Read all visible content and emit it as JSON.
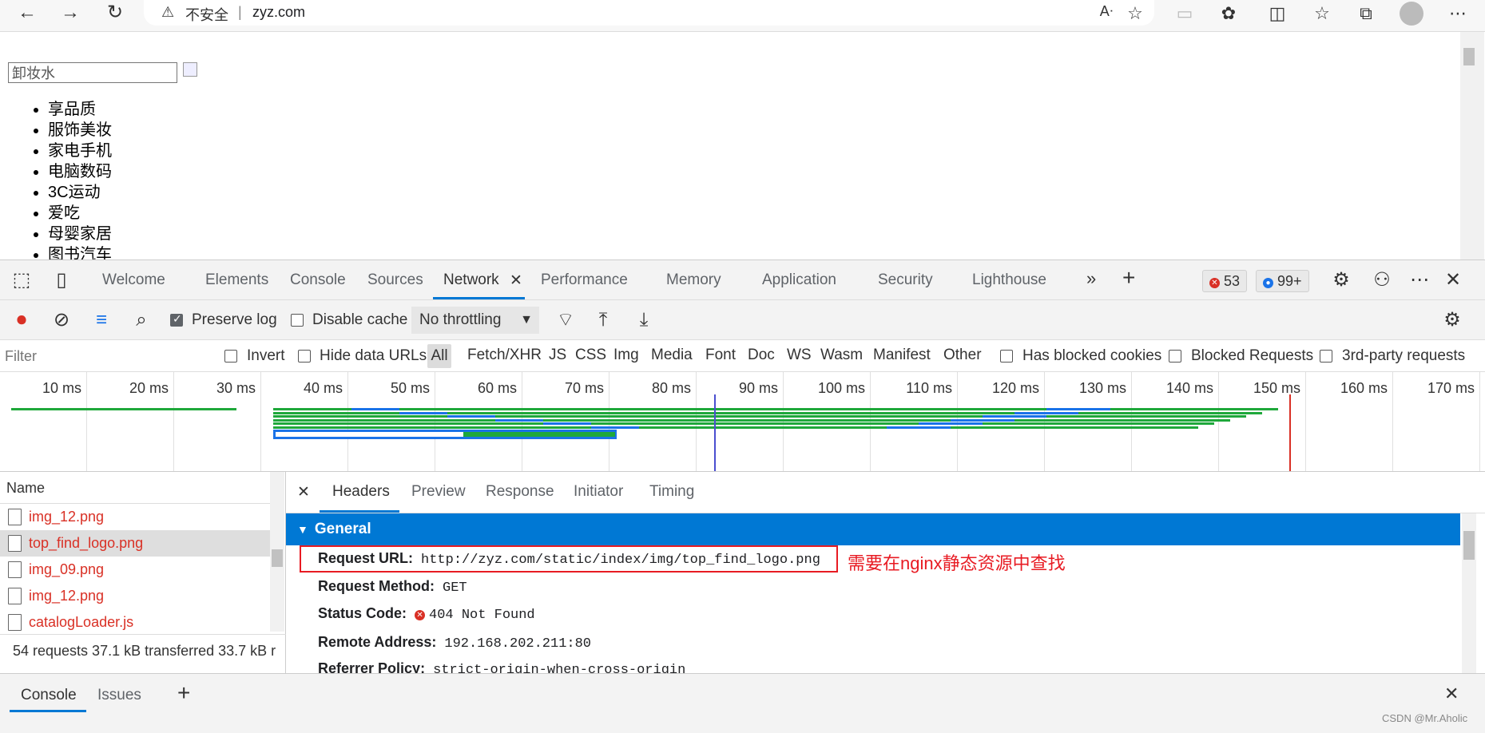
{
  "browser": {
    "security_label": "不安全",
    "address_separator": "|",
    "url": "zyz.com"
  },
  "page": {
    "search_value": "卸妆水",
    "categories": [
      "享品质",
      "服饰美妆",
      "家电手机",
      "电脑数码",
      "3C运动",
      "爱吃",
      "母婴家居",
      "图书汽车"
    ]
  },
  "devtools": {
    "tabs": [
      "Welcome",
      "Elements",
      "Console",
      "Sources",
      "Network",
      "Performance",
      "Memory",
      "Application",
      "Security",
      "Lighthouse"
    ],
    "active_tab": "Network",
    "error_count": "53",
    "message_count": "99+",
    "toolbar": {
      "preserve_log": "Preserve log",
      "disable_cache": "Disable cache",
      "throttling": "No throttling"
    },
    "filter": {
      "placeholder": "Filter",
      "invert": "Invert",
      "hide_data_urls": "Hide data URLs",
      "types": [
        "All",
        "Fetch/XHR",
        "JS",
        "CSS",
        "Img",
        "Media",
        "Font",
        "Doc",
        "WS",
        "Wasm",
        "Manifest",
        "Other"
      ],
      "has_blocked_cookies": "Has blocked cookies",
      "blocked_requests": "Blocked Requests",
      "third_party": "3rd-party requests"
    },
    "timeline_ticks": [
      "10 ms",
      "20 ms",
      "30 ms",
      "40 ms",
      "50 ms",
      "60 ms",
      "70 ms",
      "80 ms",
      "90 ms",
      "100 ms",
      "110 ms",
      "120 ms",
      "130 ms",
      "140 ms",
      "150 ms",
      "160 ms",
      "170 ms"
    ],
    "requests": {
      "column_name": "Name",
      "items": [
        "img_12.png",
        "top_find_logo.png",
        "img_09.png",
        "img_12.png",
        "catalogLoader.js"
      ],
      "selected": "top_find_logo.png",
      "summary": "54 requests  37.1 kB transferred  33.7 kB r"
    },
    "detail": {
      "tabs": [
        "Headers",
        "Preview",
        "Response",
        "Initiator",
        "Timing"
      ],
      "active_tab": "Headers",
      "section": "General",
      "rows": [
        {
          "key": "Request URL:",
          "value": "http://zyz.com/static/index/img/top_find_logo.png"
        },
        {
          "key": "Request Method:",
          "value": "GET"
        },
        {
          "key": "Status Code:",
          "value": "404 Not Found"
        },
        {
          "key": "Remote Address:",
          "value": "192.168.202.211:80"
        },
        {
          "key": "Referrer Policy:",
          "value": "strict-origin-when-cross-origin"
        }
      ],
      "annotation": "需要在nginx静态资源中查找"
    },
    "drawer": {
      "tabs": [
        "Console",
        "Issues"
      ],
      "active_tab": "Console"
    }
  },
  "watermark": "CSDN @Mr.Aholic",
  "colors": {
    "accent": "#0078d4",
    "error": "#d93025",
    "annotation": "#e81b23"
  }
}
